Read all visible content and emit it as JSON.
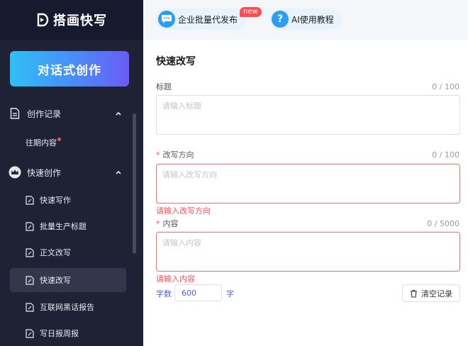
{
  "brand": {
    "name": "搭画快写"
  },
  "sidebar": {
    "create_button": "对话式创作",
    "groups": [
      {
        "label": "创作记录",
        "icon": "document-icon",
        "sub_items": [
          {
            "label": "往期内容",
            "has_dot": true
          }
        ]
      },
      {
        "label": "快速创作",
        "icon": "crown-icon"
      }
    ],
    "items": [
      {
        "label": "快速写作"
      },
      {
        "label": "批量生产标题"
      },
      {
        "label": "正文改写"
      },
      {
        "label": "快速改写",
        "active": true
      },
      {
        "label": "互联网黑话报告"
      },
      {
        "label": "写日报周报"
      }
    ]
  },
  "topbar": {
    "enterprise": {
      "label": "企业批量代发布",
      "badge": "new"
    },
    "tutorial": {
      "label": "AI使用教程",
      "icon_glyph": "?"
    }
  },
  "main": {
    "title": "快速改写",
    "fields": {
      "title": {
        "label": "标题",
        "count": "0 / 100",
        "placeholder": "请输入标题"
      },
      "direction": {
        "label": "改写方向",
        "required": "*",
        "count": "0 / 100",
        "placeholder": "请输入改写方向",
        "error": "请输入改写方向"
      },
      "content": {
        "label": "内容",
        "required": "*",
        "count": "0 / 5000",
        "placeholder": "请输入内容",
        "error": "请输入内容"
      }
    },
    "words": {
      "label": "字数",
      "value": "600",
      "unit": "字"
    },
    "clear_button": "清空记录"
  },
  "colors": {
    "sidebar_bg": "#1f2235",
    "accent": "#4a60f0",
    "error": "#ff4d4f"
  }
}
